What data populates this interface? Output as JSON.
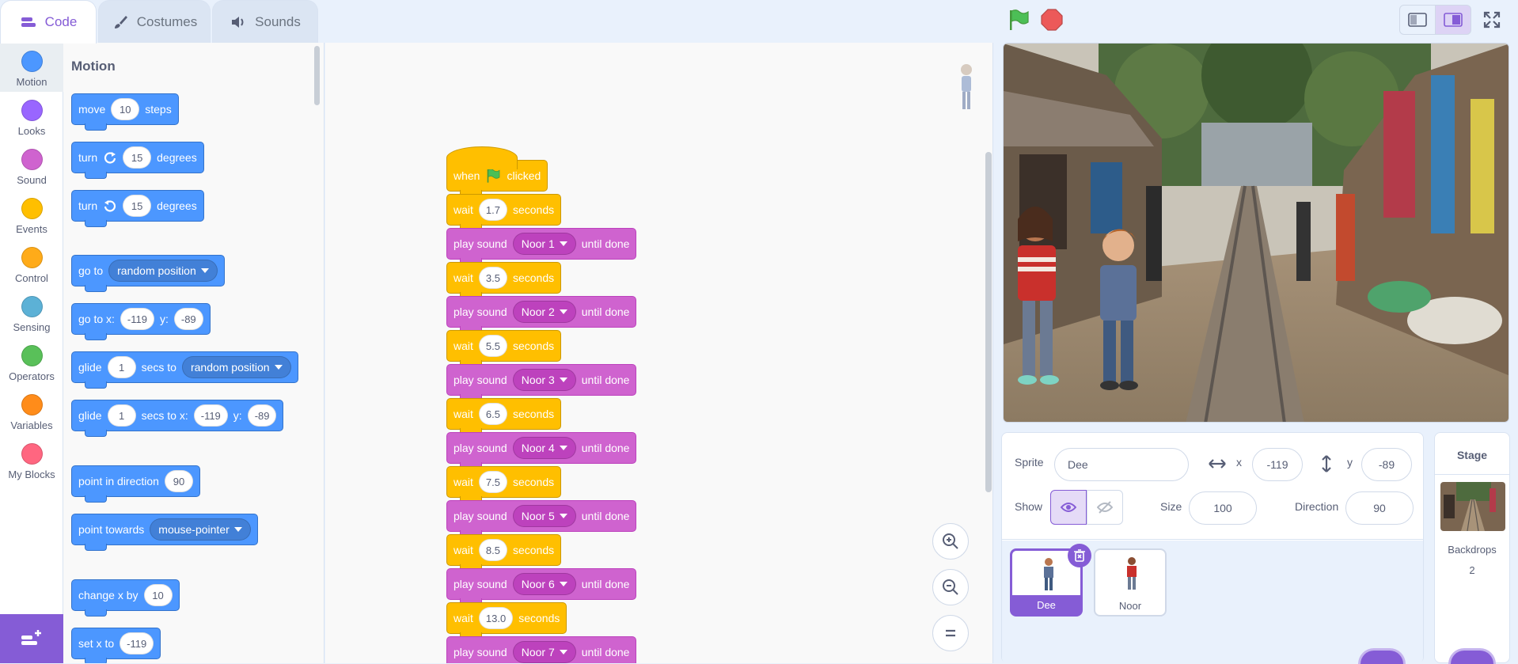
{
  "tabs": {
    "code": "Code",
    "costumes": "Costumes",
    "sounds": "Sounds"
  },
  "categories": [
    {
      "label": "Motion",
      "color": "#4c97ff"
    },
    {
      "label": "Looks",
      "color": "#9966ff"
    },
    {
      "label": "Sound",
      "color": "#cf63cf"
    },
    {
      "label": "Events",
      "color": "#ffbf00"
    },
    {
      "label": "Control",
      "color": "#ffab19"
    },
    {
      "label": "Sensing",
      "color": "#5cb1d6"
    },
    {
      "label": "Operators",
      "color": "#59c059"
    },
    {
      "label": "Variables",
      "color": "#ff8c1a"
    },
    {
      "label": "My Blocks",
      "color": "#ff6680"
    }
  ],
  "palette": {
    "title": "Motion",
    "move": {
      "pre": "move",
      "val": "10",
      "post": "steps"
    },
    "turn_right": {
      "pre": "turn",
      "val": "15",
      "post": "degrees"
    },
    "turn_left": {
      "pre": "turn",
      "val": "15",
      "post": "degrees"
    },
    "go_to": {
      "pre": "go to",
      "opt": "random position"
    },
    "go_to_xy": {
      "pre": "go to x:",
      "x": "-119",
      "ylab": "y:",
      "y": "-89"
    },
    "glide_to": {
      "pre": "glide",
      "val": "1",
      "mid": "secs to",
      "opt": "random position"
    },
    "glide_xy": {
      "pre": "glide",
      "val": "1",
      "mid": "secs to x:",
      "x": "-119",
      "ylab": "y:",
      "y": "-89"
    },
    "point_dir": {
      "pre": "point in direction",
      "val": "90"
    },
    "point_towards": {
      "pre": "point towards",
      "opt": "mouse-pointer"
    },
    "change_x": {
      "pre": "change x by",
      "val": "10"
    },
    "set_x": {
      "pre": "set x to",
      "val": "-119"
    }
  },
  "script": {
    "hat": {
      "pre": "when",
      "post": "clicked"
    },
    "steps": [
      {
        "type": "wait",
        "pre": "wait",
        "val": "1.7",
        "post": "seconds"
      },
      {
        "type": "sound",
        "pre": "play sound",
        "opt": "Noor 1",
        "post": "until done"
      },
      {
        "type": "wait",
        "pre": "wait",
        "val": "3.5",
        "post": "seconds"
      },
      {
        "type": "sound",
        "pre": "play sound",
        "opt": "Noor 2",
        "post": "until done"
      },
      {
        "type": "wait",
        "pre": "wait",
        "val": "5.5",
        "post": "seconds"
      },
      {
        "type": "sound",
        "pre": "play sound",
        "opt": "Noor 3",
        "post": "until done"
      },
      {
        "type": "wait",
        "pre": "wait",
        "val": "6.5",
        "post": "seconds"
      },
      {
        "type": "sound",
        "pre": "play sound",
        "opt": "Noor 4",
        "post": "until done"
      },
      {
        "type": "wait",
        "pre": "wait",
        "val": "7.5",
        "post": "seconds"
      },
      {
        "type": "sound",
        "pre": "play sound",
        "opt": "Noor 5",
        "post": "until done"
      },
      {
        "type": "wait",
        "pre": "wait",
        "val": "8.5",
        "post": "seconds"
      },
      {
        "type": "sound",
        "pre": "play sound",
        "opt": "Noor 6",
        "post": "until done"
      },
      {
        "type": "wait",
        "pre": "wait",
        "val": "13.0",
        "post": "seconds"
      },
      {
        "type": "sound",
        "pre": "play sound",
        "opt": "Noor 7",
        "post": "until done"
      }
    ]
  },
  "sprite_info": {
    "sprite_label": "Sprite",
    "sprite_name": "Dee",
    "x_label": "x",
    "x": "-119",
    "y_label": "y",
    "y": "-89",
    "show_label": "Show",
    "size_label": "Size",
    "size": "100",
    "direction_label": "Direction",
    "direction": "90"
  },
  "sprites": [
    {
      "name": "Dee",
      "selected": true
    },
    {
      "name": "Noor",
      "selected": false
    }
  ],
  "stage_pane": {
    "title": "Stage",
    "backdrops_label": "Backdrops",
    "backdrops_count": "2"
  }
}
